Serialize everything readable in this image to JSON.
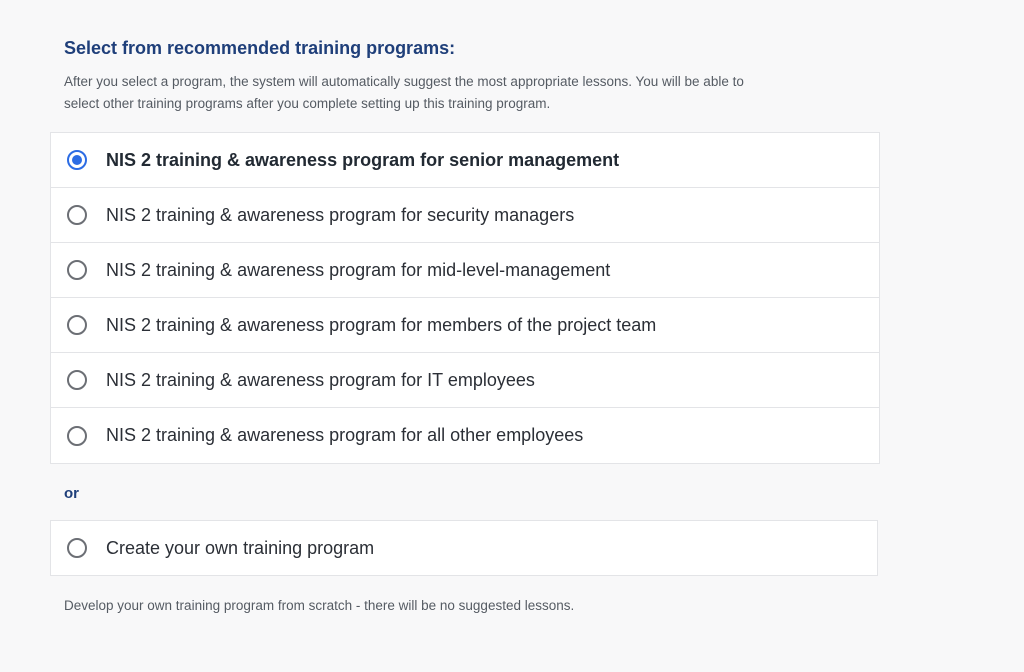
{
  "header": {
    "title": "Select from recommended training programs:",
    "description": "After you select a program, the system will automatically suggest the most appropriate lessons. You will be able to select other training programs after you complete setting up this training program."
  },
  "programs": [
    {
      "label": "NIS 2 training & awareness program for senior management",
      "selected": true
    },
    {
      "label": "NIS 2 training & awareness program for security managers",
      "selected": false
    },
    {
      "label": "NIS 2 training & awareness program for mid-level-management",
      "selected": false
    },
    {
      "label": "NIS 2 training & awareness program for members of the project team",
      "selected": false
    },
    {
      "label": "NIS 2 training & awareness program for IT employees",
      "selected": false
    },
    {
      "label": "NIS 2 training & awareness program for all other employees",
      "selected": false
    }
  ],
  "separator": "or",
  "custom": {
    "label": "Create your own training program",
    "selected": false,
    "note": "Develop your own training program from scratch - there will be no suggested lessons."
  },
  "colors": {
    "heading": "#1f3f7a",
    "accent": "#2c6ce4",
    "border": "#e3e4e7"
  }
}
